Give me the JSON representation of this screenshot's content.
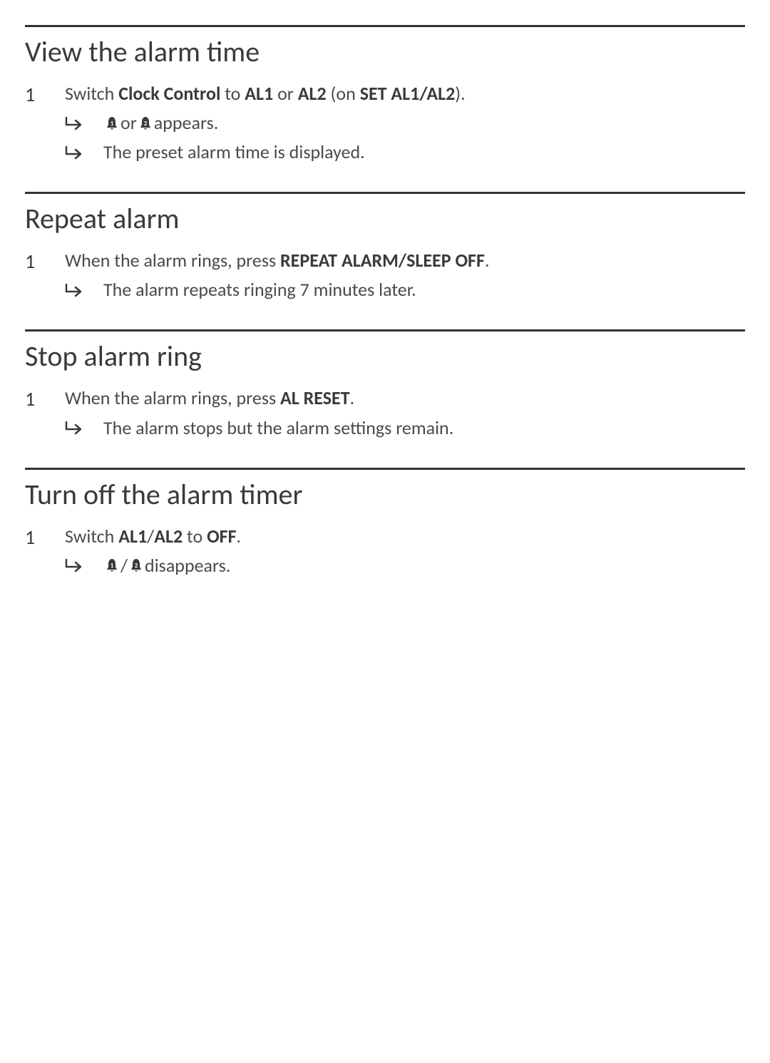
{
  "sections": [
    {
      "title": "View the alarm time",
      "step_num": "1",
      "step": {
        "pre": "Switch ",
        "b1": "Clock Control",
        "mid1": " to ",
        "b2": "AL1",
        "mid2": " or ",
        "b3": "AL2",
        "mid3": " (on ",
        "b4": "SET AL1/AL2",
        "post": ")."
      },
      "subs": [
        {
          "type": "icons_or",
          "mid": " or ",
          "after": " appears."
        },
        {
          "type": "text",
          "text": "The preset alarm time is displayed."
        }
      ]
    },
    {
      "title": "Repeat alarm",
      "step_num": "1",
      "step": {
        "pre": "When the alarm rings, press ",
        "b1": "REPEAT ALARM/SLEEP OFF",
        "post": "."
      },
      "subs": [
        {
          "type": "text",
          "text": "The alarm repeats ringing 7 minutes later."
        }
      ]
    },
    {
      "title": "Stop alarm ring",
      "step_num": "1",
      "step": {
        "pre": "When the alarm rings, press ",
        "b1": "AL RESET",
        "post": "."
      },
      "subs": [
        {
          "type": "text",
          "text": "The alarm stops but the alarm settings remain."
        }
      ]
    },
    {
      "title": "Turn off the alarm timer",
      "step_num": "1",
      "step": {
        "pre": "Switch ",
        "b1": "AL1",
        "mid1": "/",
        "b2": "AL2",
        "mid2": " to ",
        "b3": "OFF",
        "post": "."
      },
      "subs": [
        {
          "type": "icons_slash",
          "mid": "/",
          "after": " disappears."
        }
      ]
    }
  ]
}
